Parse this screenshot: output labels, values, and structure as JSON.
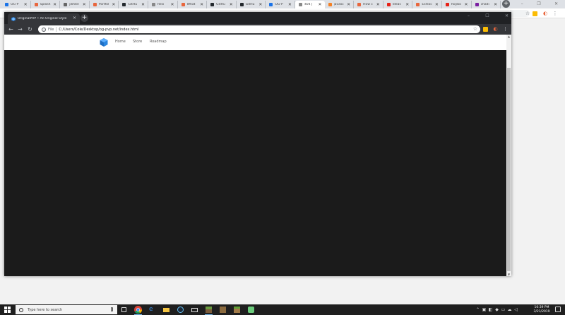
{
  "background_window": {
    "tabs": [
      {
        "title": "OG-P",
        "color": "#1a73e8"
      },
      {
        "title": "Splash",
        "color": "#e8663d"
      },
      {
        "title": "jwhite",
        "color": "#666666"
      },
      {
        "title": "Portfol",
        "color": "#e8663d"
      },
      {
        "title": "GitHu",
        "color": "#24292e"
      },
      {
        "title": "Resi",
        "color": "#888888"
      },
      {
        "title": "What",
        "color": "#e8663d"
      },
      {
        "title": "GitHu",
        "color": "#24292e"
      },
      {
        "title": "GitHu",
        "color": "#24292e"
      },
      {
        "title": "OG-P",
        "color": "#1a73e8"
      },
      {
        "title": "404 |",
        "color": "#888888",
        "active": true
      },
      {
        "title": "javasc",
        "color": "#f48024"
      },
      {
        "title": "How c",
        "color": "#e8663d"
      },
      {
        "title": "Ideas",
        "color": "#e62117"
      },
      {
        "title": "Extrac",
        "color": "#e8663d"
      },
      {
        "title": "Roybo",
        "color": "#e62117"
      },
      {
        "title": "chadi",
        "color": "#7b1fa2"
      }
    ],
    "new_tab": "+",
    "window_controls": [
      "–",
      "❐",
      "✕"
    ]
  },
  "window": {
    "tab_title": "OriginalPVP • An Original Style",
    "tab_close": "✕",
    "new_tab": "+",
    "window_controls": [
      "–",
      "☐",
      "✕"
    ],
    "nav": {
      "back": "←",
      "forward": "→",
      "reload": "↻"
    },
    "omnibox": {
      "label": "File",
      "url": "C:/Users/Cole/Desktop/og-pvp.net/index.html"
    }
  },
  "page": {
    "nav_links": [
      "Home",
      "Store",
      "Roadmap"
    ],
    "background_color": "#1b1b1b"
  },
  "taskbar": {
    "search_placeholder": "Type here to search",
    "apps": [
      "task-view",
      "chrome",
      "edge",
      "file-explorer",
      "steam",
      "mail",
      "minecraft",
      "minecraft-dungeons",
      "minecraft-launcher",
      "bluestacks"
    ],
    "clock_time": "10:39 PM",
    "clock_date": "3/21/2019"
  }
}
